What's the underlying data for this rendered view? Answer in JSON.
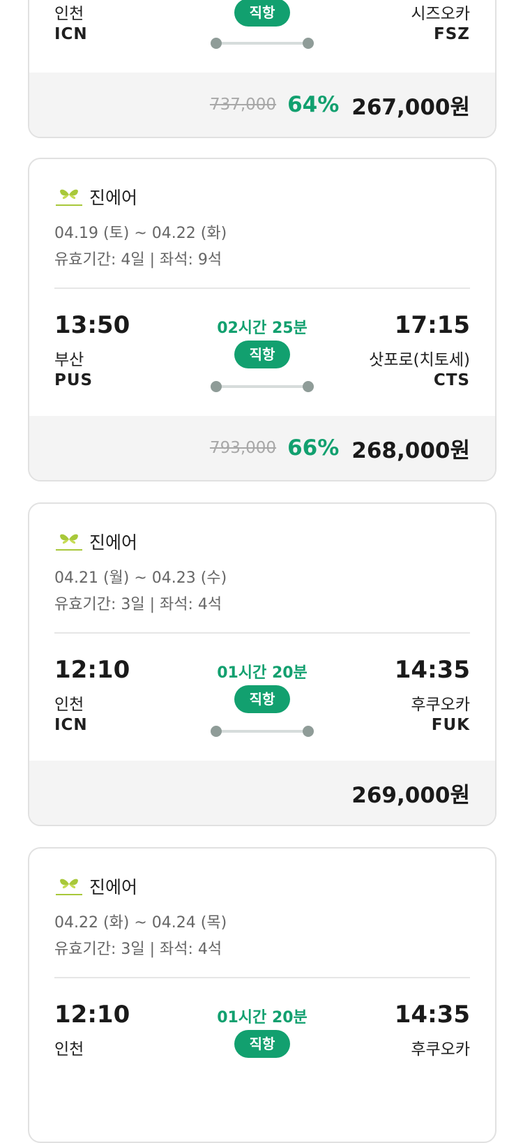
{
  "colors": {
    "accent": "#12a06f",
    "border": "#e1e1e1",
    "price_bg": "#f4f4f4"
  },
  "cards": [
    {
      "dep_city": "인천",
      "dep_code": "ICN",
      "arr_city": "시즈오카",
      "arr_code": "FSZ",
      "direct": "직항",
      "original_price": "737,000",
      "discount": "64%",
      "price": "267,000원"
    },
    {
      "airline": "진에어",
      "airline_logo": "jinair-logo-icon",
      "dates": "04.19 (토) ~ 04.22 (화)",
      "validity": "유효기간: 4일 | 좌석: 9석",
      "dep_time": "13:50",
      "arr_time": "17:15",
      "duration": "02시간 25분",
      "direct": "직항",
      "dep_city": "부산",
      "dep_code": "PUS",
      "arr_city": "삿포로(치토세)",
      "arr_code": "CTS",
      "original_price": "793,000",
      "discount": "66%",
      "price": "268,000원"
    },
    {
      "airline": "진에어",
      "airline_logo": "jinair-logo-icon",
      "dates": "04.21 (월) ~ 04.23 (수)",
      "validity": "유효기간: 3일 | 좌석: 4석",
      "dep_time": "12:10",
      "arr_time": "14:35",
      "duration": "01시간 20분",
      "direct": "직항",
      "dep_city": "인천",
      "dep_code": "ICN",
      "arr_city": "후쿠오카",
      "arr_code": "FUK",
      "price": "269,000원"
    },
    {
      "airline": "진에어",
      "airline_logo": "jinair-logo-icon",
      "dates": "04.22 (화) ~ 04.24 (목)",
      "validity": "유효기간: 3일 | 좌석: 4석",
      "dep_time": "12:10",
      "arr_time": "14:35",
      "duration": "01시간 20분",
      "direct": "직항",
      "dep_city": "인천",
      "arr_city": "후쿠오카"
    }
  ]
}
